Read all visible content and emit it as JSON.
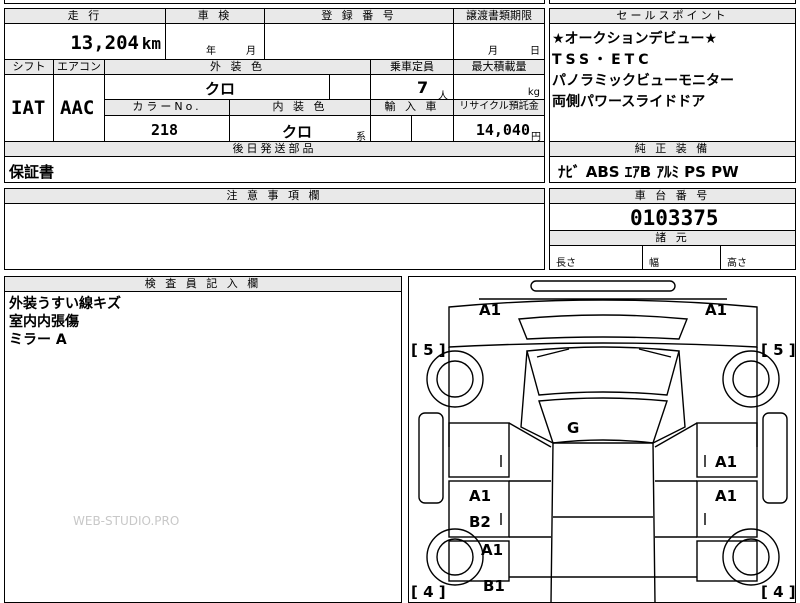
{
  "header": {
    "mileage_label": "走 行",
    "mileage_value": "13,204",
    "mileage_unit": "km",
    "inspection_label": "車 検",
    "inspection_year": "年",
    "inspection_month": "月",
    "registration_label": "登 録 番 号",
    "registration_value": "",
    "transfer_label": "譲渡書類期限",
    "transfer_month": "月",
    "transfer_day": "日"
  },
  "specs": {
    "shift_label": "シフト",
    "shift_value": "IAT",
    "ac_label": "エアコン",
    "ac_value": "AAC",
    "ext_color_label": "外 装 色",
    "ext_color_value": "クロ",
    "capacity_label": "乗車定員",
    "capacity_value": "7",
    "capacity_unit": "人",
    "maxload_label": "最大積載量",
    "maxload_unit": "kg",
    "color_no_label": "カラーNo.",
    "color_no_value": "218",
    "int_color_label": "内 装 色",
    "int_color_value": "クロ",
    "int_color_suffix": "系",
    "import_label": "輸 入 車",
    "recycle_label": "リサイクル預託金",
    "recycle_value": "14,040",
    "recycle_unit": "円"
  },
  "sales_points": {
    "label": "セールスポイント",
    "lines": [
      "★オークションデビュー★",
      "TSS・ETC",
      "パノラミックビューモニター",
      "両側パワースライドドア"
    ]
  },
  "equipment": {
    "label": "純 正 装 備",
    "value": "ﾅﾋﾞ ABS ｴｱB ｱﾙﾐ PS PW"
  },
  "later_parts": {
    "label": "後日発送部品",
    "value": "保証書"
  },
  "notes": {
    "label": "注 意 事 項 欄",
    "value": ""
  },
  "chassis": {
    "label": "車 台 番 号",
    "value": "0103375",
    "dims_label": "諸 元",
    "length_label": "長さ",
    "width_label": "幅",
    "height_label": "高さ"
  },
  "inspector": {
    "label": "検 査 員 記 入 欄",
    "lines": [
      "外装うすい線キズ",
      "室内内張傷",
      "ミラー A"
    ]
  },
  "diagram": {
    "marks": {
      "front_left": "A1",
      "front_right": "A1",
      "roof": "G",
      "right_front_door": "A1",
      "left_rear_door_a": "A1",
      "left_rear_door_b": "B2",
      "right_rear_door": "A1",
      "left_rear_fender": "A1",
      "left_rear_lower": "B1"
    },
    "tyres": {
      "front_left": "5",
      "front_right": "5",
      "rear_left": "4",
      "rear_right": "4"
    }
  },
  "watermark": "WEB-STUDIO.PRO"
}
